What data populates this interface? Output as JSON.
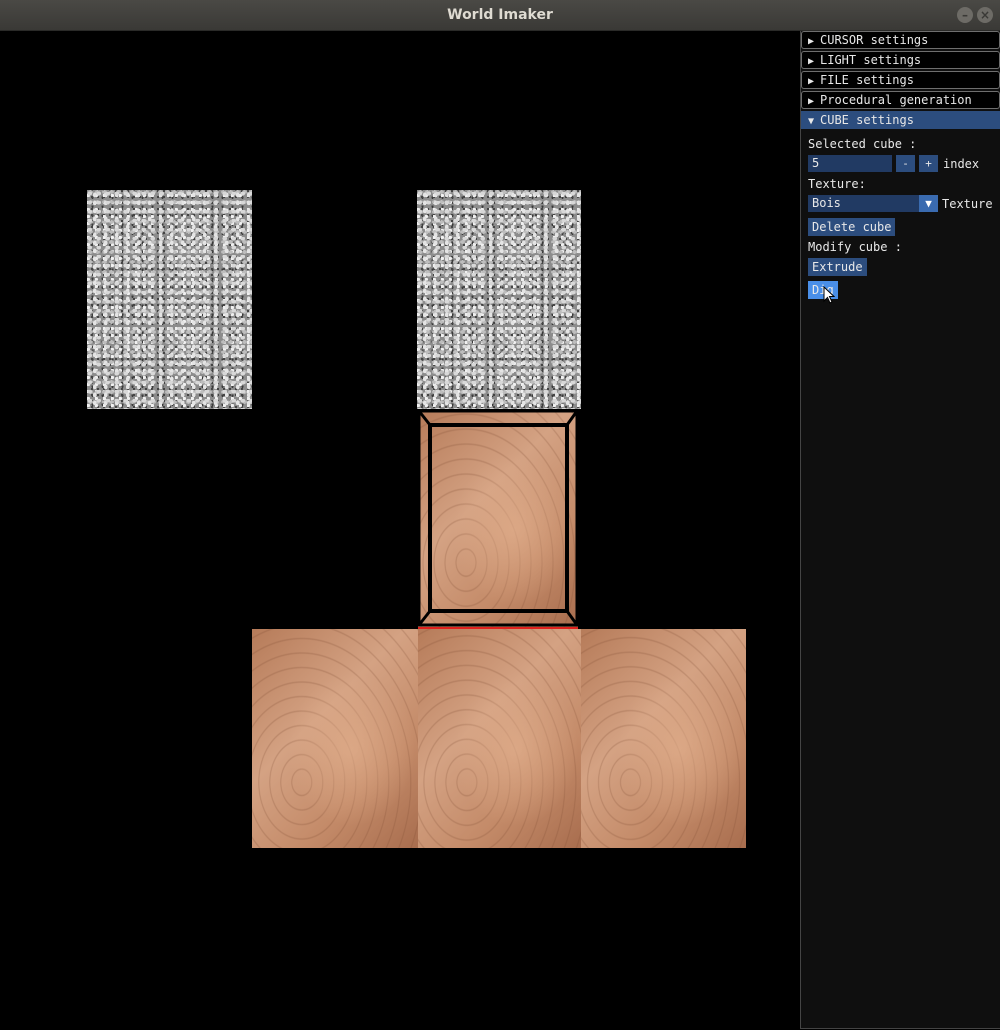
{
  "window": {
    "title": "World Imaker"
  },
  "scene": {
    "blocks": [
      {
        "texture": "stone"
      },
      {
        "texture": "stone"
      },
      {
        "texture": "wood",
        "selected": true
      },
      {
        "texture": "wood"
      },
      {
        "texture": "wood"
      },
      {
        "texture": "wood"
      }
    ],
    "highlight_color": "#e0211d"
  },
  "panel": {
    "headers": [
      {
        "label": "CURSOR settings",
        "open": false
      },
      {
        "label": "LIGHT settings",
        "open": false
      },
      {
        "label": "FILE settings",
        "open": false
      },
      {
        "label": "Procedural generation",
        "open": false
      },
      {
        "label": "CUBE settings",
        "open": true
      }
    ],
    "cube": {
      "selected_label": "Selected cube :",
      "index_value": "5",
      "minus": "-",
      "plus": "+",
      "index_label": "index",
      "texture_label": "Texture:",
      "texture_value": "Bois",
      "texture_suffix": "Texture",
      "delete_button": "Delete cube",
      "modify_label": "Modify cube :",
      "extrude_button": "Extrude",
      "dig_button": "Dig"
    }
  },
  "colors": {
    "header_active": "#2c4d7e",
    "button": "#2c4d7e",
    "button_hover": "#4a8fe8",
    "input": "#213a63"
  }
}
